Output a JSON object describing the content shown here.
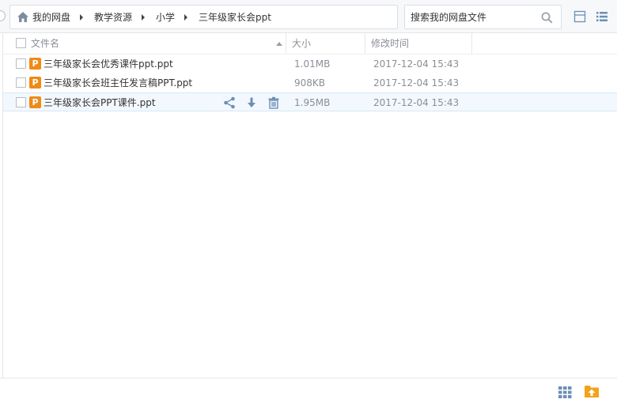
{
  "breadcrumb": {
    "items": [
      {
        "label": "我的网盘"
      },
      {
        "label": "教学资源"
      },
      {
        "label": "小学"
      },
      {
        "label": "三年级家长会ppt"
      }
    ]
  },
  "search": {
    "placeholder": "搜索我的网盘文件"
  },
  "columns": {
    "name": "文件名",
    "size": "大小",
    "modified": "修改时间"
  },
  "files": [
    {
      "name": "三年级家长会优秀课件ppt.ppt",
      "size": "1.01MB",
      "modified": "2017-12-04 15:43",
      "icon": "ppt-file-icon"
    },
    {
      "name": "三年级家长会班主任发言稿PPT.ppt",
      "size": "908KB",
      "modified": "2017-12-04 15:43",
      "icon": "ppt-file-icon"
    },
    {
      "name": "三年级家长会PPT课件.ppt",
      "size": "1.95MB",
      "modified": "2017-12-04 15:43",
      "icon": "ppt-file-icon",
      "hovered": true
    }
  ],
  "colors": {
    "accent": "#f08a16",
    "hover_row": "#f2f8fe",
    "icon_blue": "#6b8fb5"
  }
}
